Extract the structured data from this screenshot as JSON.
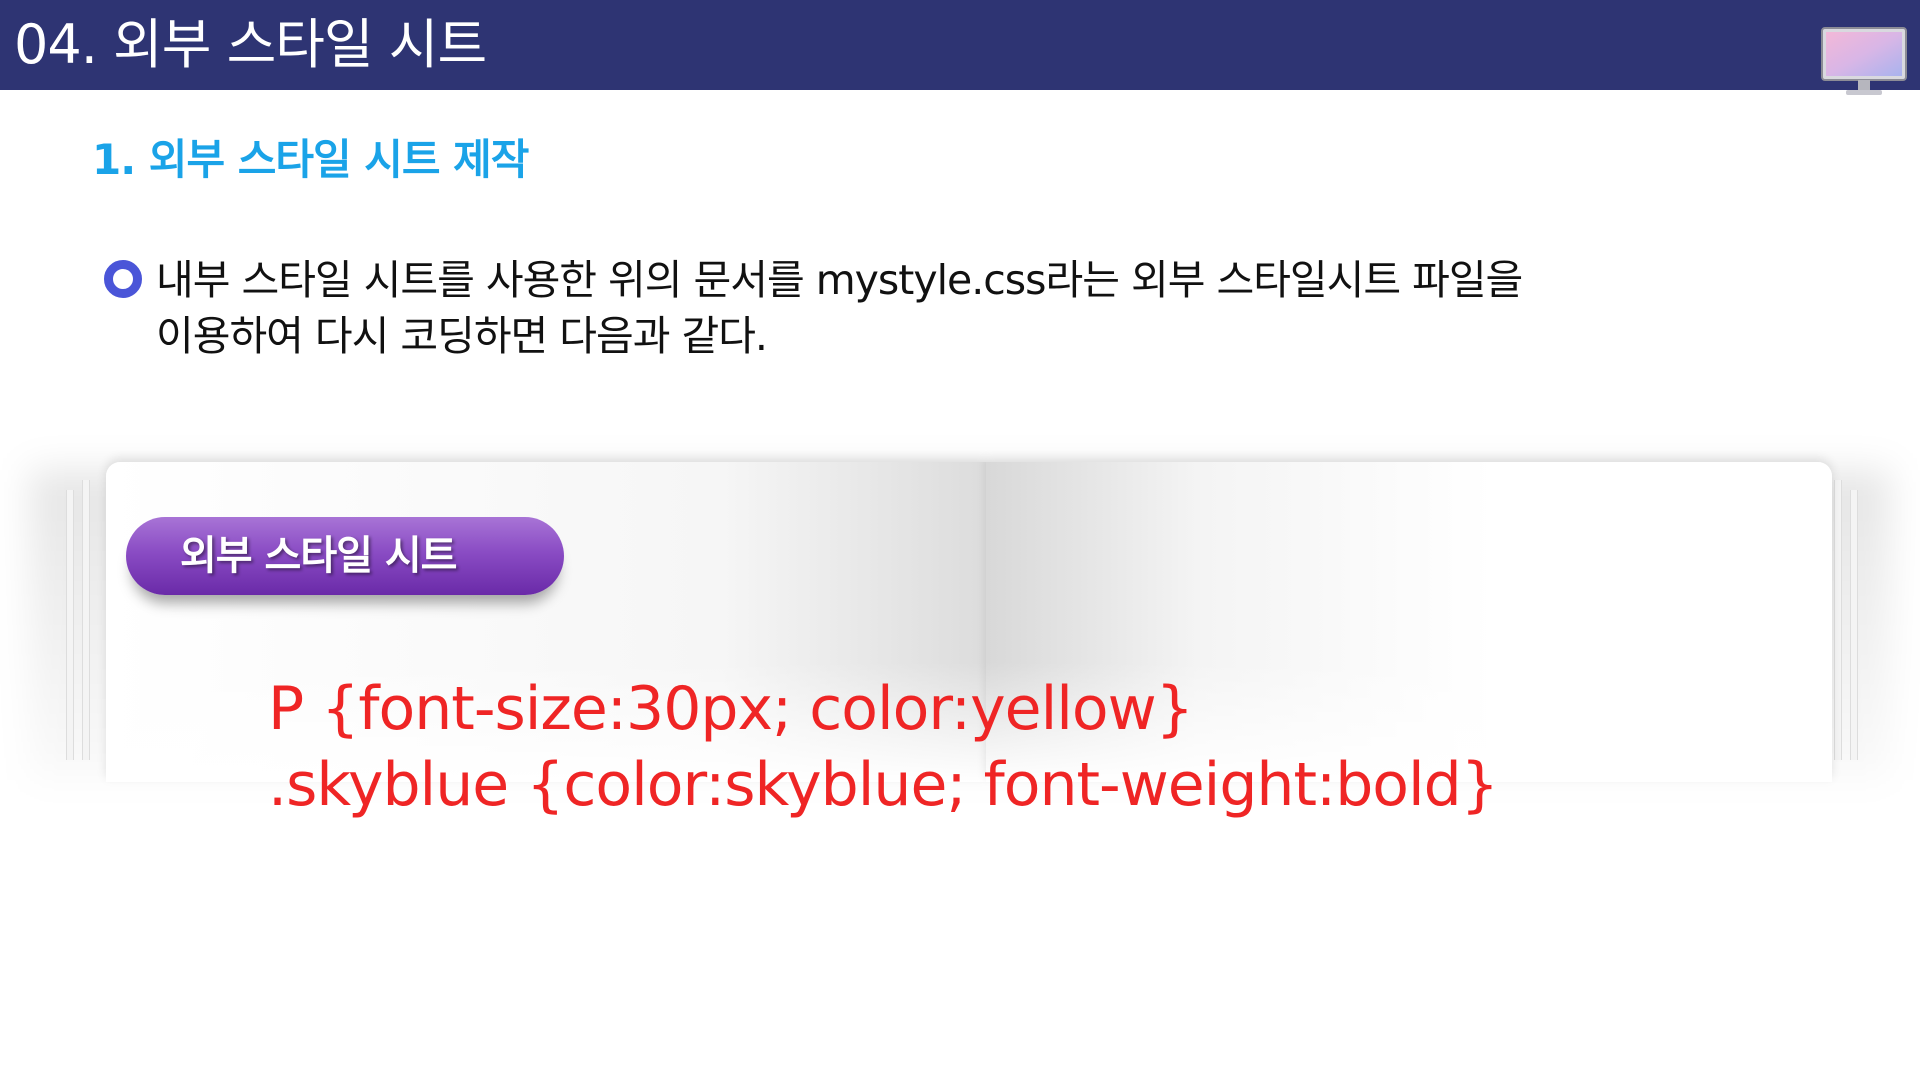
{
  "header": {
    "title": "04. 외부 스타일 시트",
    "icon": "monitor-icon"
  },
  "section": {
    "title": "1. 외부 스타일 시트 제작"
  },
  "bullet": {
    "icon": "ring-bullet-icon",
    "line1": "내부 스타일 시트를 사용한 위의 문서를 mystyle.css라는 외부 스타일시트 파일을",
    "line2": "이용하여 다시 코딩하면 다음과 같다."
  },
  "book": {
    "label": "외부 스타일 시트",
    "code_line1": "P {font-size:30px; color:yellow}",
    "code_line2": ".skyblue {color:skyblue; font-weight:bold}"
  },
  "colors": {
    "header_bg": "#2e3473",
    "section_title": "#1aa3e8",
    "bullet": "#4a55d8",
    "pill": "#8a4cc4",
    "code": "#ef2525"
  }
}
